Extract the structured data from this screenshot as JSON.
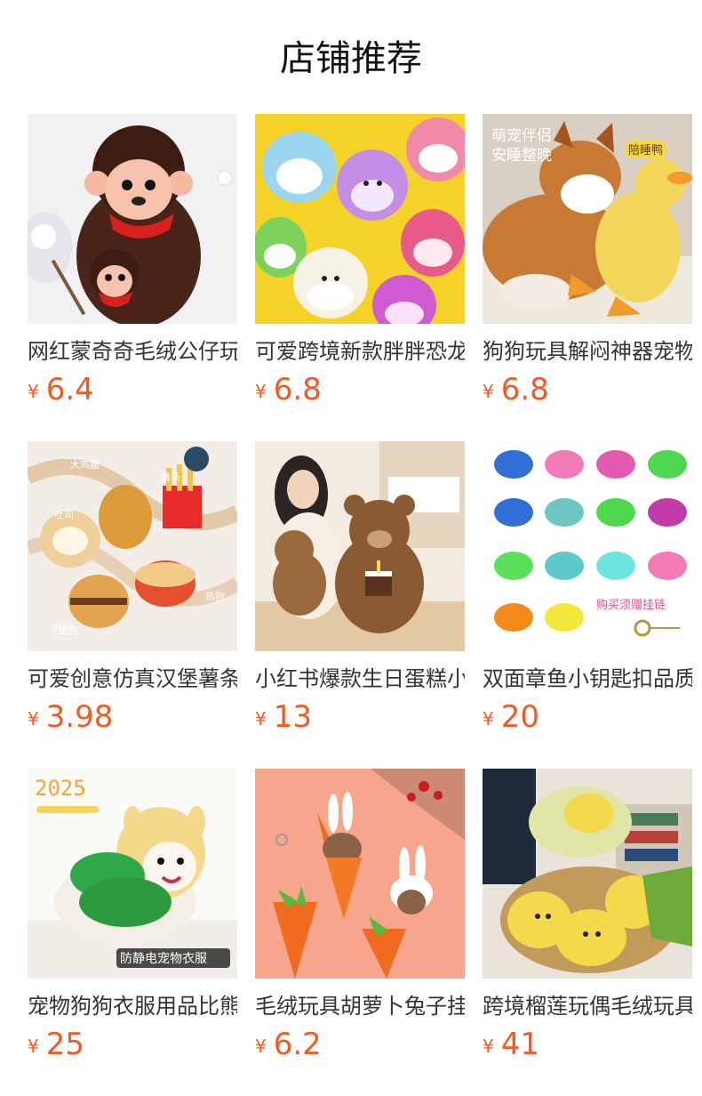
{
  "section": {
    "title": "店铺推荐"
  },
  "currency_symbol": "¥",
  "colors": {
    "price": "#f05a24"
  },
  "products": [
    {
      "name": "网红蒙奇奇毛绒公仔玩具",
      "price": "6.4",
      "icon": "monkey-plush-image"
    },
    {
      "name": "可爱跨境新款胖胖恐龙抱枕",
      "price": "6.8",
      "icon": "squishy-plush-image",
      "overlay": ""
    },
    {
      "name": "狗狗玩具解闷神器宠物鸭子",
      "price": "6.8",
      "icon": "dog-duck-toy-image",
      "overlay1": "萌宠伴侣",
      "overlay2": "安睡整晚",
      "overlay3": "陪睡鸭"
    },
    {
      "name": "可爱创意仿真汉堡薯条挂件",
      "price": "3.98",
      "icon": "food-plush-keychain-image",
      "overlay1": "大鸡腿",
      "overlay2": "吐司",
      "overlay3": "薯条",
      "overlay4": "热狗",
      "overlay5": "汉堡包"
    },
    {
      "name": "小红书爆款生日蛋糕小熊公仔",
      "price": "13",
      "icon": "birthday-bear-image"
    },
    {
      "name": "双面章鱼小钥匙扣品质挂件",
      "price": "20",
      "icon": "octopus-keychain-image",
      "overlay1": "购买须赠挂链"
    },
    {
      "name": "宠物狗狗衣服用品比熊泰迪",
      "price": "25",
      "icon": "pet-clothes-image",
      "overlay1": "2025",
      "overlay2": "防静电宠物衣服"
    },
    {
      "name": "毛绒玩具胡萝卜兔子挂件",
      "price": "6.2",
      "icon": "carrot-bunny-image"
    },
    {
      "name": "跨境榴莲玩偶毛绒玩具抱枕",
      "price": "41",
      "icon": "durian-plush-image"
    }
  ]
}
